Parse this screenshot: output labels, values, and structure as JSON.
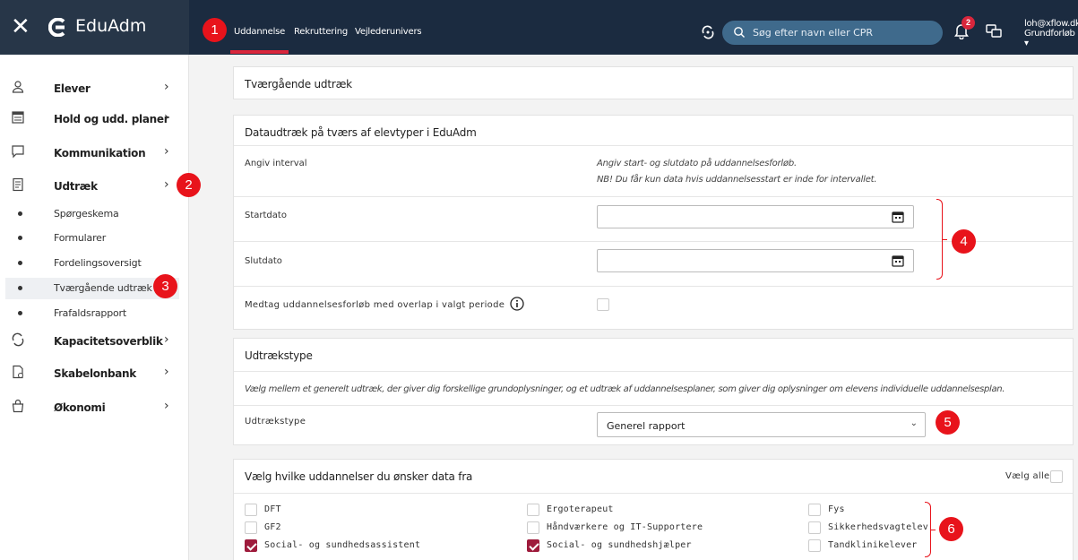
{
  "header": {
    "brand": "EduAdm",
    "tabs": [
      {
        "label": "Uddannelse",
        "active": true
      },
      {
        "label": "Rekruttering",
        "active": false
      },
      {
        "label": "Vejlederunivers",
        "active": false
      }
    ],
    "search_placeholder": "Søg efter navn eller CPR",
    "notification_count": "2",
    "user_email": "loh@xflow.dk",
    "user_role": "Grundforløb"
  },
  "sidebar": {
    "items": [
      {
        "label": "Elever",
        "icon": "person-icon"
      },
      {
        "label": "Hold og udd. planer",
        "icon": "calendar-icon"
      },
      {
        "label": "Kommunikation",
        "icon": "chat-icon"
      },
      {
        "label": "Udtræk",
        "icon": "document-icon"
      }
    ],
    "subitems": [
      {
        "label": "Spørgeskema",
        "active": false
      },
      {
        "label": "Formularer",
        "active": false
      },
      {
        "label": "Fordelingsoversigt",
        "active": false
      },
      {
        "label": "Tværgående udtræk",
        "active": true
      },
      {
        "label": "Frafaldsrapport",
        "active": false
      }
    ],
    "items2": [
      {
        "label": "Kapacitetsoverblik",
        "icon": "capacity-icon"
      },
      {
        "label": "Skabelonbank",
        "icon": "template-icon"
      },
      {
        "label": "Økonomi",
        "icon": "bag-icon"
      }
    ]
  },
  "markers": [
    "1",
    "2",
    "3",
    "4",
    "5",
    "6"
  ],
  "page_title": "Tværgående udtræk",
  "data_section": {
    "title": "Dataudtræk på tværs af elevtyper i EduAdm",
    "interval_label": "Angiv interval",
    "interval_help_1": "Angiv start- og slutdato på uddannelsesforløb.",
    "interval_help_2": "NB! Du får kun data hvis uddannelsesstart er inde for intervallet.",
    "start_label": "Startdato",
    "end_label": "Slutdato",
    "overlap_label": "Medtag uddannelsesforløb med overlap i valgt periode"
  },
  "type_section": {
    "title": "Udtrækstype",
    "description": "Vælg mellem et generelt udtræk, der giver dig forskellige grundoplysninger, og et udtræk af uddannelsesplaner, som giver dig oplysninger om elevens individuelle uddannelsesplan.",
    "select_label": "Udtrækstype",
    "select_value": "Generel rapport"
  },
  "edu_section": {
    "title": "Vælg hvilke uddannelser du ønsker data fra",
    "select_all": "Vælg alle",
    "options": [
      {
        "label": "DFT",
        "checked": false
      },
      {
        "label": "GF2",
        "checked": false
      },
      {
        "label": "Social- og sundhedsassistent",
        "checked": true
      },
      {
        "label": "Ergoterapeut",
        "checked": false
      },
      {
        "label": "Håndværkere og IT-Supportere",
        "checked": false
      },
      {
        "label": "Social- og sundhedshjælper",
        "checked": true
      },
      {
        "label": "Fys",
        "checked": false
      },
      {
        "label": "Sikkerhedsvagtelev",
        "checked": false
      },
      {
        "label": "Tandklinikelever",
        "checked": false
      }
    ]
  },
  "colors": {
    "topbar": "#1b2b40",
    "accent": "#d9263c",
    "checkbox": "#9e1b3c",
    "marker": "#e8131b"
  }
}
